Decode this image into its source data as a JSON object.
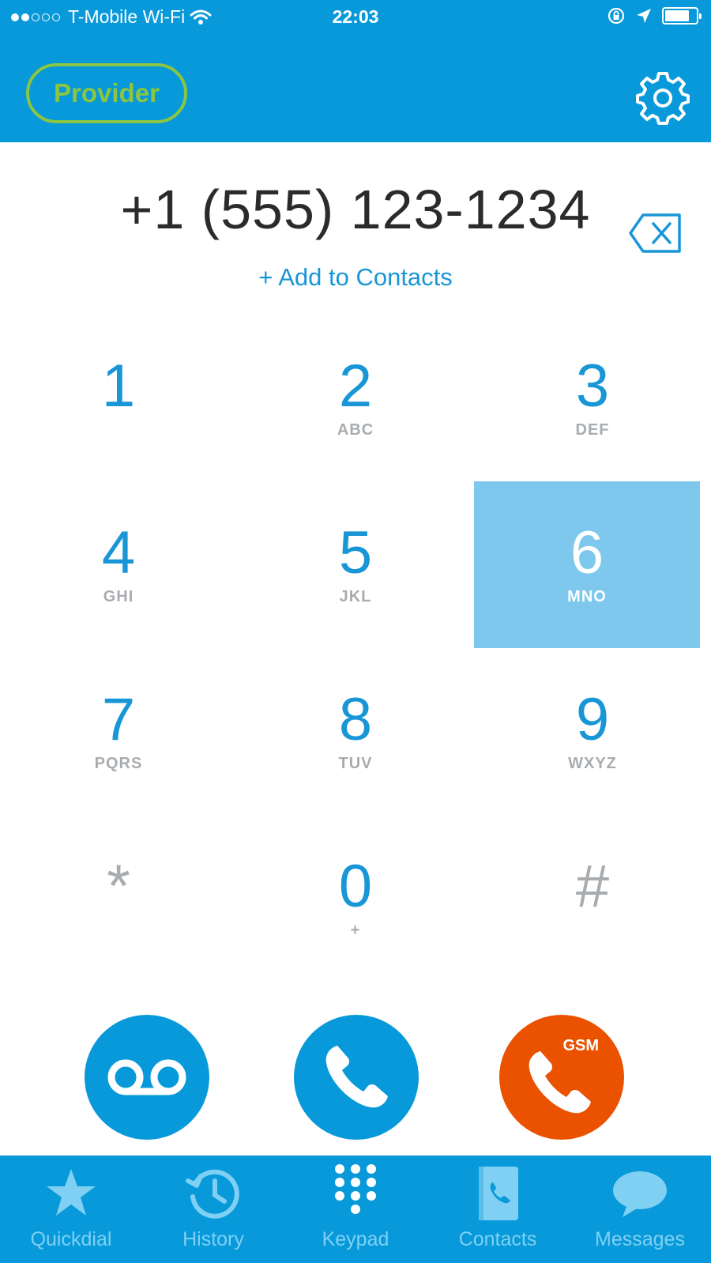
{
  "status_bar": {
    "carrier": "T-Mobile Wi-Fi",
    "time": "22:03",
    "signal_bars_filled": 2,
    "signal_bars_total": 5,
    "battery_level": 0.8
  },
  "header": {
    "provider_label": "Provider",
    "settings_icon": "gear-icon"
  },
  "dialer": {
    "number": "+1 (555) 123-1234",
    "add_to_contacts": "+ Add to Contacts",
    "delete_icon": "backspace-icon"
  },
  "keypad": {
    "keys": [
      {
        "digit": "1",
        "letters": ""
      },
      {
        "digit": "2",
        "letters": "ABC"
      },
      {
        "digit": "3",
        "letters": "DEF"
      },
      {
        "digit": "4",
        "letters": "GHI"
      },
      {
        "digit": "5",
        "letters": "JKL"
      },
      {
        "digit": "6",
        "letters": "MNO"
      },
      {
        "digit": "7",
        "letters": "PQRS"
      },
      {
        "digit": "8",
        "letters": "TUV"
      },
      {
        "digit": "9",
        "letters": "WXYZ"
      },
      {
        "digit": "*",
        "letters": ""
      },
      {
        "digit": "0",
        "letters": "+"
      },
      {
        "digit": "#",
        "letters": ""
      }
    ],
    "pressed_key": "6"
  },
  "actions": {
    "voicemail_icon": "voicemail-icon",
    "call_icon": "phone-icon",
    "gsm_call_label": "GSM"
  },
  "tabbar": {
    "tabs": [
      {
        "label": "Quickdial",
        "icon": "star-icon"
      },
      {
        "label": "History",
        "icon": "history-clock-icon"
      },
      {
        "label": "Keypad",
        "icon": "keypad-dots-icon"
      },
      {
        "label": "Contacts",
        "icon": "contacts-book-icon"
      },
      {
        "label": "Messages",
        "icon": "chat-bubble-icon"
      }
    ]
  },
  "colors": {
    "primary": "#0799d9",
    "accent_green": "#8bc541",
    "gsm_orange": "#ea5200",
    "key_active": "#7ec8ed",
    "digit_blue": "#1896d6"
  }
}
